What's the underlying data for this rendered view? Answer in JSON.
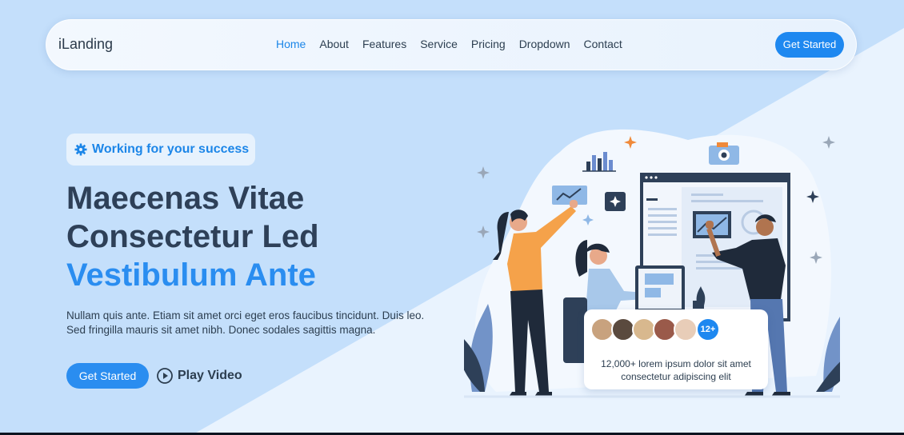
{
  "header": {
    "logo": "iLanding",
    "nav": [
      "Home",
      "About",
      "Features",
      "Service",
      "Pricing",
      "Dropdown",
      "Contact"
    ],
    "active": "Home",
    "cta": "Get Started"
  },
  "hero": {
    "badge": "Working for your success",
    "title_line1": "Maecenas Vitae",
    "title_line2": "Consectetur Led",
    "title_line3": "Vestibulum Ante",
    "paragraph": "Nullam quis ante. Etiam sit amet orci eget eros faucibus tincidunt. Duis leo. Sed fringilla mauris sit amet nibh. Donec sodales sagittis magna.",
    "cta": "Get Started",
    "play_label": "Play Video"
  },
  "card": {
    "count": "12+",
    "text_line1": "12,000+ lorem ipsum dolor sit amet",
    "text_line2": "consectetur adipiscing elit"
  },
  "colors": {
    "accent": "#1e88f0",
    "heading": "#2e4058",
    "background": "#c4dffb"
  }
}
